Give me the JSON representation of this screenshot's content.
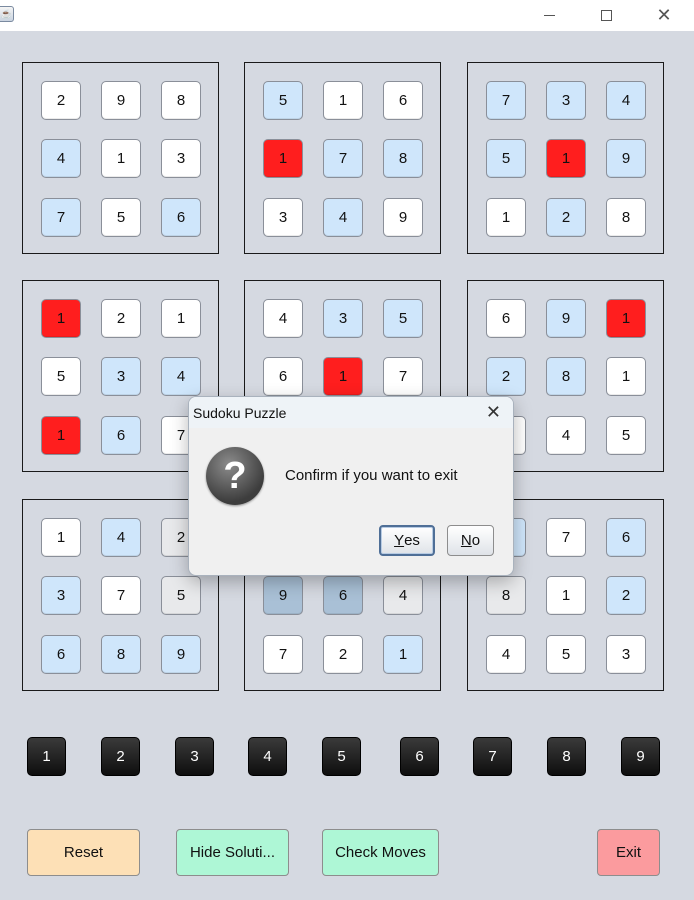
{
  "window": {
    "icon": "java-cup-icon",
    "controls": [
      "minimize-icon",
      "maximize-icon",
      "close-icon"
    ]
  },
  "grid": {
    "boxes": [
      {
        "cells": [
          {
            "v": "2",
            "c": "white"
          },
          {
            "v": "9",
            "c": "white"
          },
          {
            "v": "8",
            "c": "white"
          },
          {
            "v": "4",
            "c": "blue"
          },
          {
            "v": "1",
            "c": "white"
          },
          {
            "v": "3",
            "c": "white"
          },
          {
            "v": "7",
            "c": "blue"
          },
          {
            "v": "5",
            "c": "white"
          },
          {
            "v": "6",
            "c": "blue"
          }
        ]
      },
      {
        "cells": [
          {
            "v": "5",
            "c": "blue"
          },
          {
            "v": "1",
            "c": "white"
          },
          {
            "v": "6",
            "c": "white"
          },
          {
            "v": "1",
            "c": "red"
          },
          {
            "v": "7",
            "c": "blue"
          },
          {
            "v": "8",
            "c": "blue"
          },
          {
            "v": "3",
            "c": "white"
          },
          {
            "v": "4",
            "c": "blue"
          },
          {
            "v": "9",
            "c": "white"
          }
        ]
      },
      {
        "cells": [
          {
            "v": "7",
            "c": "blue"
          },
          {
            "v": "3",
            "c": "blue"
          },
          {
            "v": "4",
            "c": "blue"
          },
          {
            "v": "5",
            "c": "blue"
          },
          {
            "v": "1",
            "c": "red"
          },
          {
            "v": "9",
            "c": "blue"
          },
          {
            "v": "1",
            "c": "white"
          },
          {
            "v": "2",
            "c": "blue"
          },
          {
            "v": "8",
            "c": "white"
          }
        ]
      },
      {
        "cells": [
          {
            "v": "1",
            "c": "red"
          },
          {
            "v": "2",
            "c": "white"
          },
          {
            "v": "1",
            "c": "white"
          },
          {
            "v": "5",
            "c": "white"
          },
          {
            "v": "3",
            "c": "blue"
          },
          {
            "v": "4",
            "c": "blue"
          },
          {
            "v": "1",
            "c": "red"
          },
          {
            "v": "6",
            "c": "blue"
          },
          {
            "v": "7",
            "c": "white"
          }
        ]
      },
      {
        "cells": [
          {
            "v": "4",
            "c": "white"
          },
          {
            "v": "3",
            "c": "blue"
          },
          {
            "v": "5",
            "c": "blue"
          },
          {
            "v": "6",
            "c": "white"
          },
          {
            "v": "1",
            "c": "red"
          },
          {
            "v": "7",
            "c": "white"
          },
          {
            "v": "",
            "c": "white"
          },
          {
            "v": "",
            "c": "white"
          },
          {
            "v": "",
            "c": "white"
          }
        ]
      },
      {
        "cells": [
          {
            "v": "6",
            "c": "white"
          },
          {
            "v": "9",
            "c": "blue"
          },
          {
            "v": "1",
            "c": "red"
          },
          {
            "v": "2",
            "c": "blue"
          },
          {
            "v": "8",
            "c": "blue"
          },
          {
            "v": "1",
            "c": "white"
          },
          {
            "v": "",
            "c": "white"
          },
          {
            "v": "4",
            "c": "white"
          },
          {
            "v": "5",
            "c": "white"
          }
        ]
      },
      {
        "cells": [
          {
            "v": "1",
            "c": "white"
          },
          {
            "v": "4",
            "c": "blue"
          },
          {
            "v": "2",
            "c": "gray"
          },
          {
            "v": "3",
            "c": "blue"
          },
          {
            "v": "7",
            "c": "white"
          },
          {
            "v": "5",
            "c": "gray"
          },
          {
            "v": "6",
            "c": "blue"
          },
          {
            "v": "8",
            "c": "blue"
          },
          {
            "v": "9",
            "c": "blue"
          }
        ]
      },
      {
        "cells": [
          {
            "v": "",
            "c": "white"
          },
          {
            "v": "",
            "c": "white"
          },
          {
            "v": "",
            "c": "white"
          },
          {
            "v": "9",
            "c": "dblue"
          },
          {
            "v": "6",
            "c": "dblue"
          },
          {
            "v": "4",
            "c": "gray"
          },
          {
            "v": "7",
            "c": "white"
          },
          {
            "v": "2",
            "c": "white"
          },
          {
            "v": "1",
            "c": "blue"
          }
        ]
      },
      {
        "cells": [
          {
            "v": "",
            "c": "blue"
          },
          {
            "v": "7",
            "c": "white"
          },
          {
            "v": "6",
            "c": "blue"
          },
          {
            "v": "8",
            "c": "gray"
          },
          {
            "v": "1",
            "c": "white"
          },
          {
            "v": "2",
            "c": "blue"
          },
          {
            "v": "4",
            "c": "white"
          },
          {
            "v": "5",
            "c": "white"
          },
          {
            "v": "3",
            "c": "white"
          }
        ]
      }
    ]
  },
  "number_pad": [
    "1",
    "2",
    "3",
    "4",
    "5",
    "6",
    "7",
    "8",
    "9"
  ],
  "actions": {
    "reset": "Reset",
    "hide_solution": "Hide Soluti...",
    "check_moves": "Check Moves",
    "exit": "Exit"
  },
  "colors": {
    "white": "#ffffff",
    "blue": "#cfe6fb",
    "red": "#ff1e1e",
    "gray": "#e8e9eb",
    "dblue": "#a9c0d6",
    "reset_bg": "#fde0b6",
    "green_bg": "#aef7d6",
    "exit_bg": "#fb9b9e"
  },
  "dialog": {
    "title": "Sudoku Puzzle",
    "message": "Confirm if you want to exit",
    "icon": "question-icon",
    "yes_mnemonic": "Y",
    "yes_rest": "es",
    "no_mnemonic": "N",
    "no_rest": "o"
  }
}
